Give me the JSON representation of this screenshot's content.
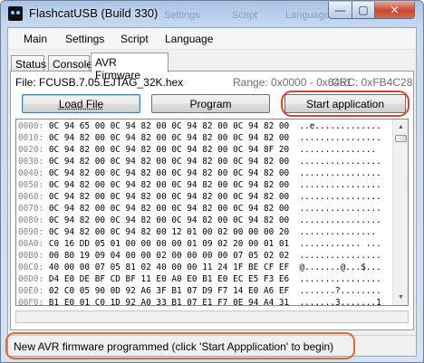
{
  "window": {
    "title": "FlashcatUSB (Build 330)",
    "ghost_menu": [
      "Settings",
      "Script",
      "Language"
    ],
    "controls": {
      "minimize": "—",
      "maximize": "▢",
      "close": "✕"
    }
  },
  "menubar": {
    "items": [
      "Main",
      "Settings",
      "Script",
      "Language"
    ]
  },
  "tabs": [
    {
      "label": "Status",
      "active": false
    },
    {
      "label": "Console",
      "active": false
    },
    {
      "label": "AVR Firmware",
      "active": true
    }
  ],
  "avr": {
    "file": "File: FCUSB.7.05.EJTAG_32K.hex",
    "range": "Range: 0x0000 - 0x6451",
    "crc": "CRC: 0xFB4C28",
    "buttons": {
      "load": "Load File",
      "program": "Program",
      "start": "Start application"
    }
  },
  "hex_lines": [
    {
      "addr": "0000:",
      "data": "0C 94 65 00 0C 94 82 00 0C 94 82 00 0C 94 82 00",
      "ascii": "..e............."
    },
    {
      "addr": "0010:",
      "data": "0C 94 82 00 0C 94 82 00 0C 94 82 00 0C 94 82 00",
      "ascii": "................"
    },
    {
      "addr": "0020:",
      "data": "0C 94 82 00 0C 94 82 00 0C 94 82 00 0C 94 8F 20",
      "ascii": "..............."
    },
    {
      "addr": "0030:",
      "data": "0C 94 82 00 0C 94 82 00 0C 94 82 00 0C 94 82 00",
      "ascii": "................"
    },
    {
      "addr": "0040:",
      "data": "0C 94 82 00 0C 94 82 00 0C 94 82 00 0C 94 82 00",
      "ascii": "................"
    },
    {
      "addr": "0050:",
      "data": "0C 94 82 00 0C 94 82 00 0C 94 82 00 0C 94 82 00",
      "ascii": "................"
    },
    {
      "addr": "0060:",
      "data": "0C 94 82 00 0C 94 82 00 0C 94 82 00 0C 94 82 00",
      "ascii": "................"
    },
    {
      "addr": "0070:",
      "data": "0C 94 82 00 0C 94 82 00 0C 94 82 00 0C 94 82 00",
      "ascii": "................"
    },
    {
      "addr": "0080:",
      "data": "0C 94 82 00 0C 94 82 00 0C 94 82 00 0C 94 82 00",
      "ascii": "................"
    },
    {
      "addr": "0090:",
      "data": "0C 94 82 00 0C 94 82 00 12 01 00 02 00 00 00 20",
      "ascii": "..............."
    },
    {
      "addr": "00A0:",
      "data": "C0 16 DD 05 01 00 00 00 00 01 09 02 20 00 01 01",
      "ascii": "............ ..."
    },
    {
      "addr": "00B0:",
      "data": "00 80 19 09 04 00 00 02 00 00 00 00 07 05 02 02",
      "ascii": "................"
    },
    {
      "addr": "00C0:",
      "data": "40 00 00 07 05 81 02 40 00 00 11 24 1F BE CF EF",
      "ascii": "@.......@...$..."
    },
    {
      "addr": "00D0:",
      "data": "D4 E0 DE BF CD BF 11 E0 A0 E0 B1 E0 EC E5 F3 E6",
      "ascii": "................"
    },
    {
      "addr": "00E0:",
      "data": "02 C0 05 90 0D 92 A6 3F B1 07 D9 F7 14 E0 A6 EF",
      "ascii": ".......?........"
    },
    {
      "addr": "00F0:",
      "data": "B1 E0 01 C0 1D 92 A0 33 B1 07 E1 F7 0E 94 A4 31",
      "ascii": ".......3.......1"
    }
  ],
  "statusbar": {
    "text": "New AVR firmware programmed (click 'Start Appplication' to begin)"
  },
  "colors": {
    "highlight_start": "#d9442a",
    "highlight_status": "#e8692f",
    "close_button": "#c8462f"
  }
}
